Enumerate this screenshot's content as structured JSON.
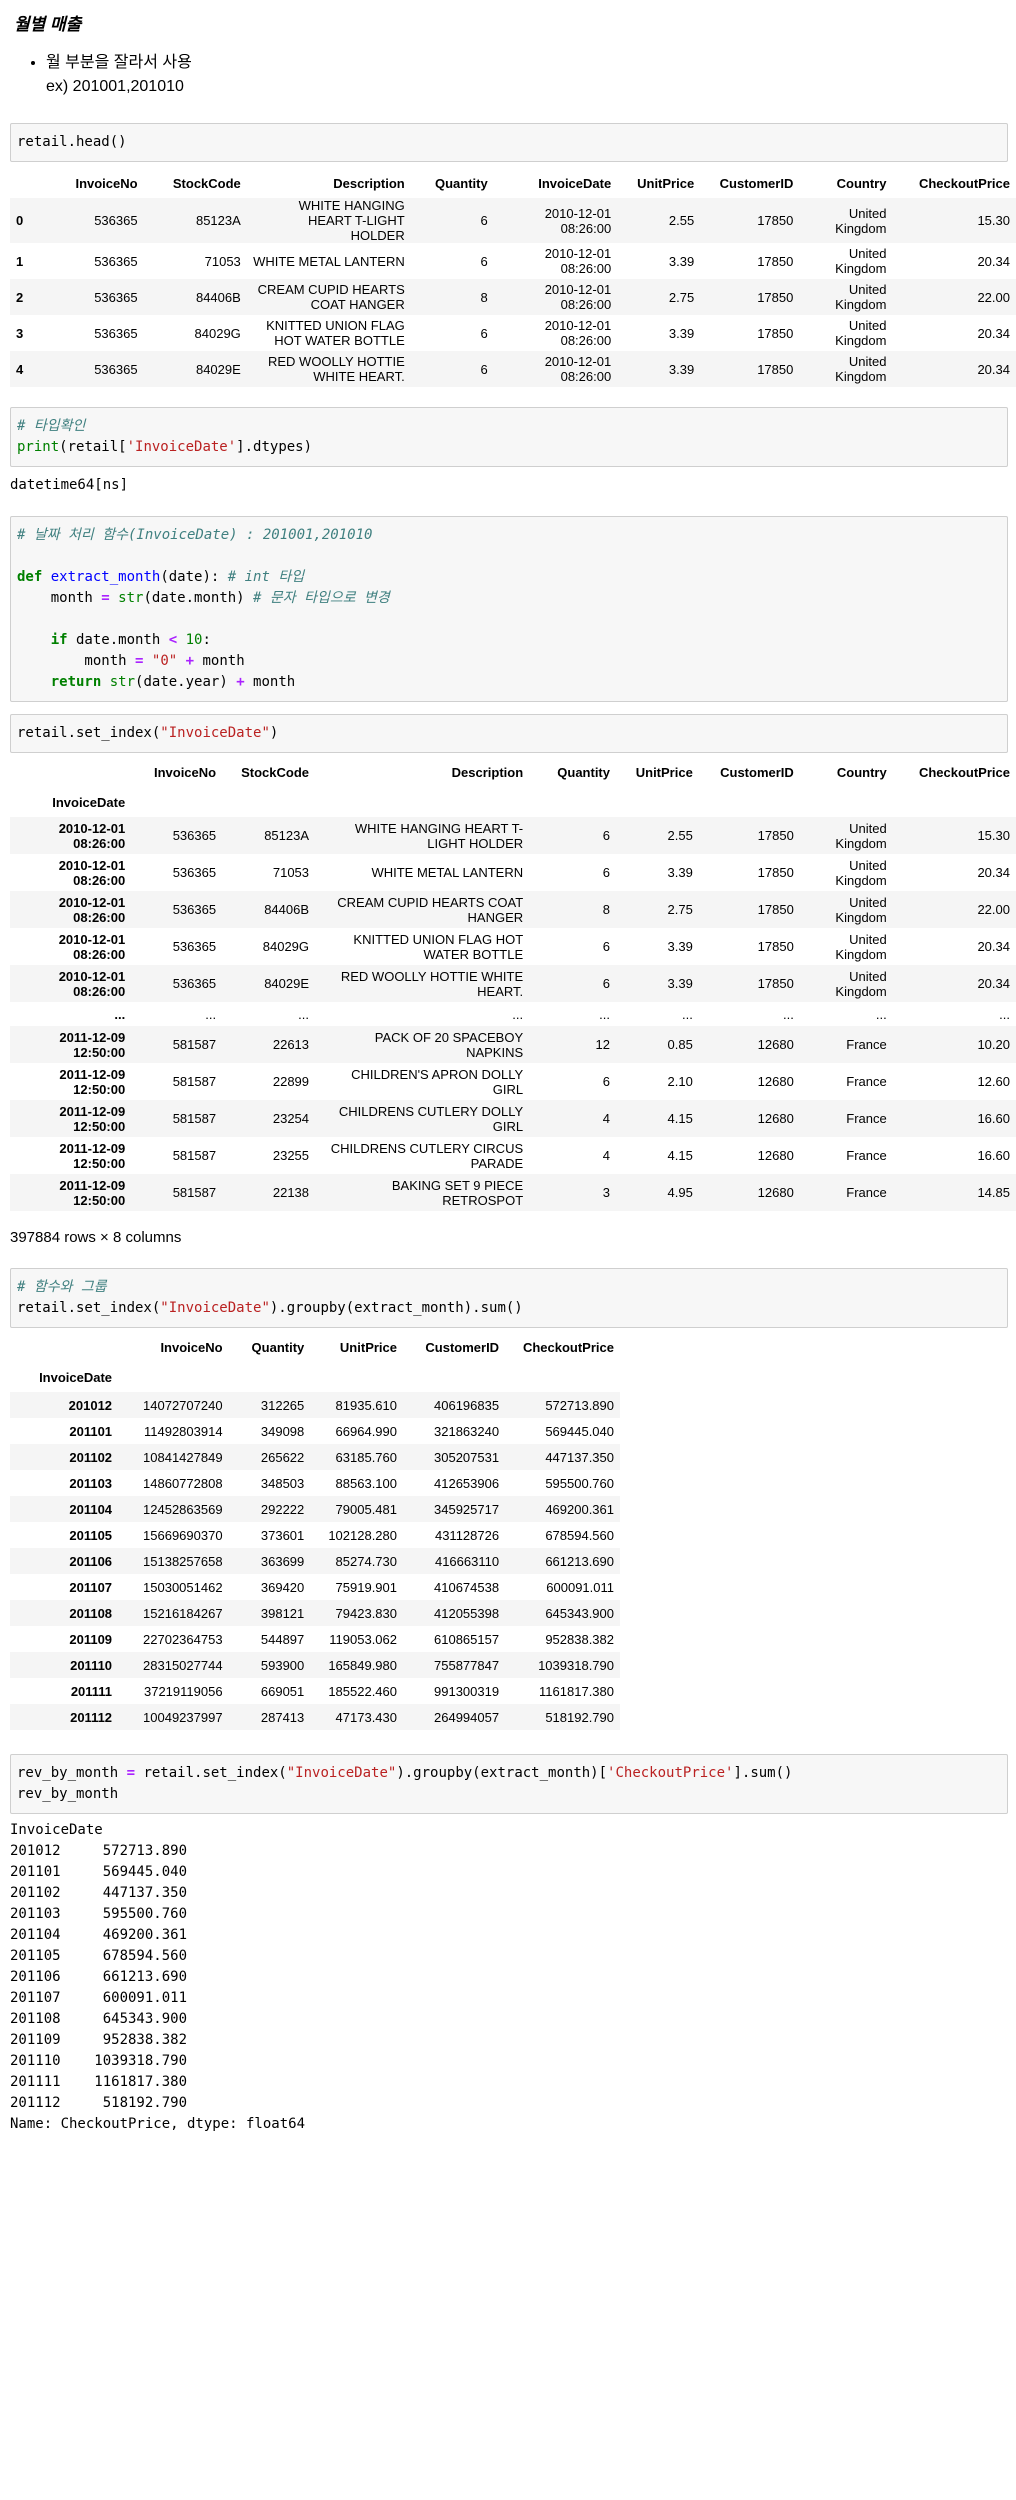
{
  "markdown": {
    "heading": "월별 매출",
    "bullet_line1": "월 부분을 잘라서 사용",
    "bullet_line2": "ex) 201001,201010"
  },
  "cell1": {
    "code": "retail.head()",
    "columns": [
      "",
      "InvoiceNo",
      "StockCode",
      "Description",
      "Quantity",
      "InvoiceDate",
      "UnitPrice",
      "CustomerID",
      "Country",
      "CheckoutPrice"
    ],
    "rows": [
      [
        "0",
        "536365",
        "85123A",
        "WHITE HANGING HEART T-LIGHT HOLDER",
        "6",
        "2010-12-01 08:26:00",
        "2.55",
        "17850",
        "United Kingdom",
        "15.30"
      ],
      [
        "1",
        "536365",
        "71053",
        "WHITE METAL LANTERN",
        "6",
        "2010-12-01 08:26:00",
        "3.39",
        "17850",
        "United Kingdom",
        "20.34"
      ],
      [
        "2",
        "536365",
        "84406B",
        "CREAM CUPID HEARTS COAT HANGER",
        "8",
        "2010-12-01 08:26:00",
        "2.75",
        "17850",
        "United Kingdom",
        "22.00"
      ],
      [
        "3",
        "536365",
        "84029G",
        "KNITTED UNION FLAG HOT WATER BOTTLE",
        "6",
        "2010-12-01 08:26:00",
        "3.39",
        "17850",
        "United Kingdom",
        "20.34"
      ],
      [
        "4",
        "536365",
        "84029E",
        "RED WOOLLY HOTTIE WHITE HEART.",
        "6",
        "2010-12-01 08:26:00",
        "3.39",
        "17850",
        "United Kingdom",
        "20.34"
      ]
    ]
  },
  "cell2": {
    "comment": "# 타입확인",
    "print_fn": "print",
    "print_open": "(retail[",
    "print_str": "'InvoiceDate'",
    "print_close": "].dtypes)",
    "output": "datetime64[ns]"
  },
  "cell3": {
    "comment": "# 날짜 처리 함수(InvoiceDate) : 201001,201010",
    "def_kw": "def",
    "fn_name": "extract_month",
    "fn_sig": "(date):",
    "fn_comment": "# int 타입",
    "l2_a": "    month ",
    "l2_eq": "=",
    "l2_sp": " ",
    "l2_str": "str",
    "l2_b": "(date.month) ",
    "l2_comment": "# 문자 타입으로 변경",
    "l4_if": "    if",
    "l4_b": " date.month ",
    "l4_lt": "<",
    "l4_sp": " ",
    "l4_num": "10",
    "l4_colon": ":",
    "l5_a": "        month ",
    "l5_eq": "=",
    "l5_sp": " ",
    "l5_str": "\"0\"",
    "l5_sp2": " ",
    "l5_plus": "+",
    "l5_b": " month",
    "l6_ret": "    return",
    "l6_sp": " ",
    "l6_str": "str",
    "l6_b": "(date.year) ",
    "l6_plus": "+",
    "l6_c": " month"
  },
  "cell4": {
    "code_a": "retail.set_index(",
    "code_str": "\"InvoiceDate\"",
    "code_b": ")",
    "columns": [
      "",
      "InvoiceNo",
      "StockCode",
      "Description",
      "Quantity",
      "UnitPrice",
      "CustomerID",
      "Country",
      "CheckoutPrice"
    ],
    "index_name": "InvoiceDate",
    "rows": [
      [
        "2010-12-01 08:26:00",
        "536365",
        "85123A",
        "WHITE HANGING HEART T-LIGHT HOLDER",
        "6",
        "2.55",
        "17850",
        "United Kingdom",
        "15.30"
      ],
      [
        "2010-12-01 08:26:00",
        "536365",
        "71053",
        "WHITE METAL LANTERN",
        "6",
        "3.39",
        "17850",
        "United Kingdom",
        "20.34"
      ],
      [
        "2010-12-01 08:26:00",
        "536365",
        "84406B",
        "CREAM CUPID HEARTS COAT HANGER",
        "8",
        "2.75",
        "17850",
        "United Kingdom",
        "22.00"
      ],
      [
        "2010-12-01 08:26:00",
        "536365",
        "84029G",
        "KNITTED UNION FLAG HOT WATER BOTTLE",
        "6",
        "3.39",
        "17850",
        "United Kingdom",
        "20.34"
      ],
      [
        "2010-12-01 08:26:00",
        "536365",
        "84029E",
        "RED WOOLLY HOTTIE WHITE HEART.",
        "6",
        "3.39",
        "17850",
        "United Kingdom",
        "20.34"
      ],
      [
        "...",
        "...",
        "...",
        "...",
        "...",
        "...",
        "...",
        "...",
        "..."
      ],
      [
        "2011-12-09 12:50:00",
        "581587",
        "22613",
        "PACK OF 20 SPACEBOY NAPKINS",
        "12",
        "0.85",
        "12680",
        "France",
        "10.20"
      ],
      [
        "2011-12-09 12:50:00",
        "581587",
        "22899",
        "CHILDREN'S APRON DOLLY GIRL",
        "6",
        "2.10",
        "12680",
        "France",
        "12.60"
      ],
      [
        "2011-12-09 12:50:00",
        "581587",
        "23254",
        "CHILDRENS CUTLERY DOLLY GIRL",
        "4",
        "4.15",
        "12680",
        "France",
        "16.60"
      ],
      [
        "2011-12-09 12:50:00",
        "581587",
        "23255",
        "CHILDRENS CUTLERY CIRCUS PARADE",
        "4",
        "4.15",
        "12680",
        "France",
        "16.60"
      ],
      [
        "2011-12-09 12:50:00",
        "581587",
        "22138",
        "BAKING SET 9 PIECE RETROSPOT",
        "3",
        "4.95",
        "12680",
        "France",
        "14.85"
      ]
    ],
    "shape": "397884 rows × 8 columns"
  },
  "cell5": {
    "comment": "# 함수와 그룹",
    "code_a": "retail.set_index(",
    "code_str": "\"InvoiceDate\"",
    "code_b": ").groupby(extract_month).sum()",
    "columns": [
      "",
      "InvoiceNo",
      "Quantity",
      "UnitPrice",
      "CustomerID",
      "CheckoutPrice"
    ],
    "index_name": "InvoiceDate",
    "rows": [
      [
        "201012",
        "14072707240",
        "312265",
        "81935.610",
        "406196835",
        "572713.890"
      ],
      [
        "201101",
        "11492803914",
        "349098",
        "66964.990",
        "321863240",
        "569445.040"
      ],
      [
        "201102",
        "10841427849",
        "265622",
        "63185.760",
        "305207531",
        "447137.350"
      ],
      [
        "201103",
        "14860772808",
        "348503",
        "88563.100",
        "412653906",
        "595500.760"
      ],
      [
        "201104",
        "12452863569",
        "292222",
        "79005.481",
        "345925717",
        "469200.361"
      ],
      [
        "201105",
        "15669690370",
        "373601",
        "102128.280",
        "431128726",
        "678594.560"
      ],
      [
        "201106",
        "15138257658",
        "363699",
        "85274.730",
        "416663110",
        "661213.690"
      ],
      [
        "201107",
        "15030051462",
        "369420",
        "75919.901",
        "410674538",
        "600091.011"
      ],
      [
        "201108",
        "15216184267",
        "398121",
        "79423.830",
        "412055398",
        "645343.900"
      ],
      [
        "201109",
        "22702364753",
        "544897",
        "119053.062",
        "610865157",
        "952838.382"
      ],
      [
        "201110",
        "28315027744",
        "593900",
        "165849.980",
        "755877847",
        "1039318.790"
      ],
      [
        "201111",
        "37219119056",
        "669051",
        "185522.460",
        "991300319",
        "1161817.380"
      ],
      [
        "201112",
        "10049237997",
        "287413",
        "47173.430",
        "264994057",
        "518192.790"
      ]
    ]
  },
  "cell6": {
    "l1_a": "rev_by_month ",
    "l1_eq": "=",
    "l1_b": " retail.set_index(",
    "l1_str": "\"InvoiceDate\"",
    "l1_c": ").groupby(extract_month)[",
    "l1_str2": "'CheckoutPrice'",
    "l1_d": "].sum()",
    "l2": "rev_by_month",
    "output_header": "InvoiceDate",
    "series": [
      [
        "201012",
        "572713.890"
      ],
      [
        "201101",
        "569445.040"
      ],
      [
        "201102",
        "447137.350"
      ],
      [
        "201103",
        "595500.760"
      ],
      [
        "201104",
        "469200.361"
      ],
      [
        "201105",
        "678594.560"
      ],
      [
        "201106",
        "661213.690"
      ],
      [
        "201107",
        "600091.011"
      ],
      [
        "201108",
        "645343.900"
      ],
      [
        "201109",
        "952838.382"
      ],
      [
        "201110",
        "1039318.790"
      ],
      [
        "201111",
        "1161817.380"
      ],
      [
        "201112",
        "518192.790"
      ]
    ],
    "output_footer": "Name: CheckoutPrice, dtype: float64"
  }
}
